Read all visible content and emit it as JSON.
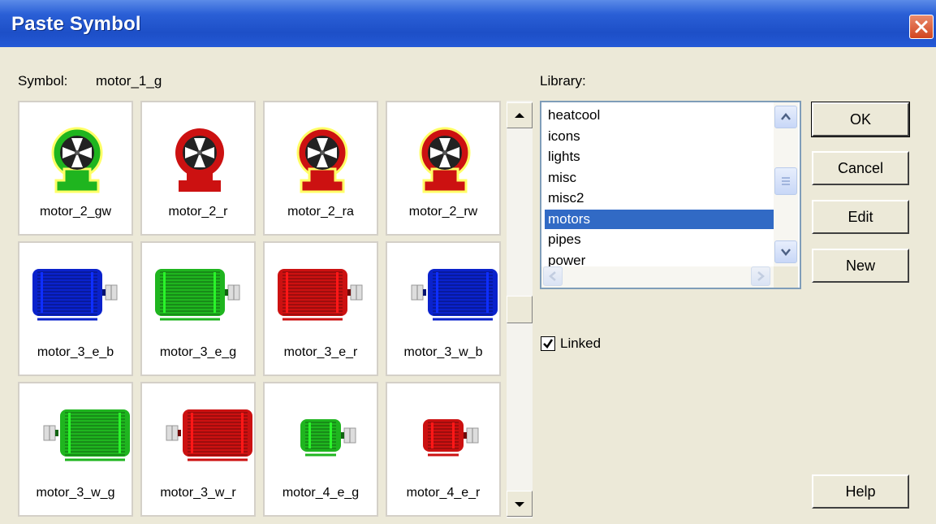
{
  "window": {
    "title": "Paste Symbol"
  },
  "symbol": {
    "label": "Symbol:",
    "value": "motor_1_g"
  },
  "library": {
    "label": "Library:",
    "items": [
      "heatcool",
      "icons",
      "lights",
      "misc",
      "misc2",
      "motors",
      "pipes",
      "power"
    ],
    "selected": "motors"
  },
  "symbols": [
    {
      "name": "motor_2_gw",
      "kind": "fan",
      "color": "#1fb51f",
      "halo": "#ffff66"
    },
    {
      "name": "motor_2_r",
      "kind": "fan",
      "color": "#cc1111",
      "halo": ""
    },
    {
      "name": "motor_2_ra",
      "kind": "fan",
      "color": "#cc1111",
      "halo": "#ffff66"
    },
    {
      "name": "motor_2_rw",
      "kind": "fan",
      "color": "#cc1111",
      "halo": "#ffff66"
    },
    {
      "name": "motor_3_e_b",
      "kind": "motor-large-left",
      "color": "#0a22cc"
    },
    {
      "name": "motor_3_e_g",
      "kind": "motor-large-left",
      "color": "#1fb51f"
    },
    {
      "name": "motor_3_e_r",
      "kind": "motor-large-left",
      "color": "#cc1111"
    },
    {
      "name": "motor_3_w_b",
      "kind": "motor-large-right",
      "color": "#0a22cc"
    },
    {
      "name": "motor_3_w_g",
      "kind": "motor-large-right",
      "color": "#1fb51f"
    },
    {
      "name": "motor_3_w_r",
      "kind": "motor-large-right",
      "color": "#cc1111"
    },
    {
      "name": "motor_4_e_g",
      "kind": "motor-small-left",
      "color": "#1fb51f"
    },
    {
      "name": "motor_4_e_r",
      "kind": "motor-small-left",
      "color": "#cc1111"
    }
  ],
  "buttons": {
    "ok": "OK",
    "cancel": "Cancel",
    "edit": "Edit",
    "new": "New",
    "help": "Help"
  },
  "linked": {
    "label": "Linked",
    "checked": true
  }
}
